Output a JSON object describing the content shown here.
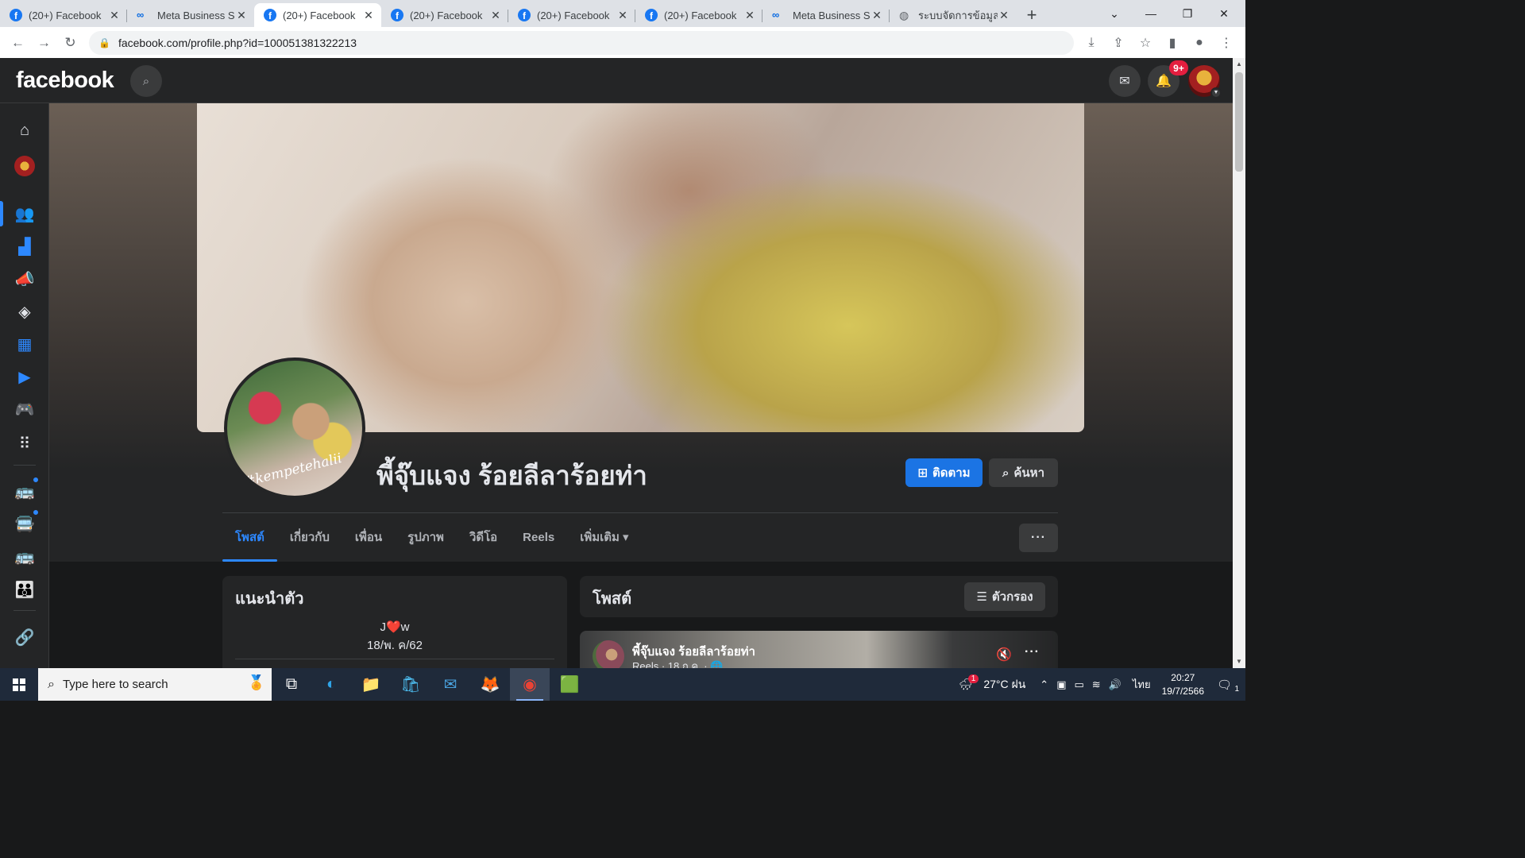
{
  "browser": {
    "tabs": [
      {
        "label": "(20+) Facebook",
        "icon": "facebook-icon",
        "active": false
      },
      {
        "label": "Meta Business Su",
        "icon": "meta-icon",
        "active": false
      },
      {
        "label": "(20+) Facebook",
        "icon": "facebook-icon",
        "active": true
      },
      {
        "label": "(20+) Facebook",
        "icon": "facebook-icon",
        "active": false
      },
      {
        "label": "(20+) Facebook",
        "icon": "facebook-icon",
        "active": false
      },
      {
        "label": "(20+) Facebook",
        "icon": "facebook-icon",
        "active": false
      },
      {
        "label": "Meta Business Su",
        "icon": "meta-icon",
        "active": false
      },
      {
        "label": "ระบบจัดการข้อมูล",
        "icon": "globe-icon",
        "active": false
      }
    ],
    "url": "facebook.com/profile.php?id=100051381322213"
  },
  "fb": {
    "logo": "facebook",
    "notif_badge": "9+"
  },
  "profile": {
    "name": "พี้จุ๊บแจง ร้อยลีลาร้อยท่า",
    "avatar_watermark": "#kempetehalii",
    "follow_label": "ติดตาม",
    "search_label": "ค้นหา",
    "more_label": "···",
    "tabs": [
      "โพสต์",
      "เกี่ยวกับ",
      "เพื่อน",
      "รูปภาพ",
      "วิดีโอ",
      "Reels",
      "เพิ่มเติม ▾"
    ]
  },
  "intro": {
    "title": "แนะนำตัว",
    "bio_line1": "J❤️w",
    "bio_line2": "18/พ. ค/62"
  },
  "posts": {
    "title": "โพสต์",
    "filter_label": "ตัวกรอง",
    "first_post": {
      "author": "พี้จุ๊บแจง ร้อยลีลาร้อยท่า",
      "meta": "Reels · 18 ก.ค. · 🌐"
    }
  },
  "taskbar": {
    "search_placeholder": "Type here to search",
    "weather": "27°C ฝน",
    "weather_badge": "1",
    "language": "ไทย",
    "time": "20:27",
    "date": "19/7/2566",
    "notif_count": "1"
  }
}
